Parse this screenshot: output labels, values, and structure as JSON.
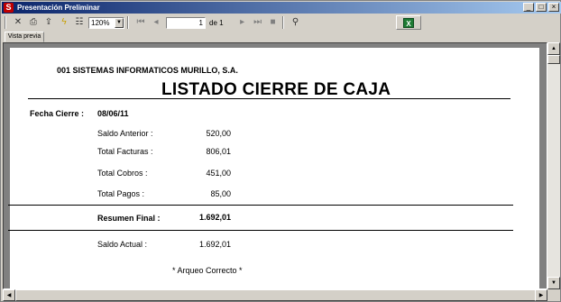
{
  "window": {
    "title": "Presentación Preliminar",
    "buttons": {
      "minimize": "_",
      "maximize": "□",
      "close": "×"
    }
  },
  "toolbar": {
    "icons": [
      "close-icon",
      "print-icon",
      "export-icon",
      "lightning-icon",
      "options-icon"
    ],
    "zoom_value": "120%",
    "page_value": "1",
    "page_of": "de 1",
    "excel_label": "X"
  },
  "tab": {
    "label": "Vista previa"
  },
  "report": {
    "company": "001  SISTEMAS INFORMATICOS MURILLO, S.A.",
    "title": "LISTADO CIERRE DE CAJA",
    "date_label": "Fecha Cierre :",
    "date_value": "08/06/11",
    "rows": [
      {
        "label": "Saldo Anterior :",
        "value": "520,00"
      },
      {
        "label": "Total Facturas :",
        "value": "806,01"
      },
      {
        "label": "Total Cobros :",
        "value": "451,00"
      },
      {
        "label": "Total Pagos :",
        "value": "85,00"
      }
    ],
    "summary_label": "Resumen Final :",
    "summary_value": "1.692,01",
    "current_label": "Saldo Actual :",
    "current_value": "1.692,01",
    "note": "* Arqueo Correcto *"
  }
}
